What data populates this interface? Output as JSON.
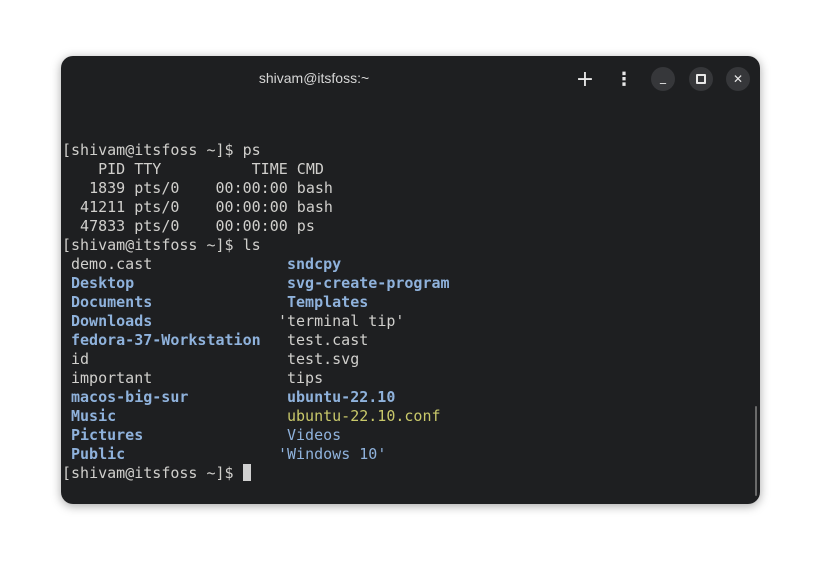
{
  "window": {
    "title": "shivam@itsfoss:~"
  },
  "header_buttons": {
    "new_tab": "+",
    "menu": "⋮",
    "minimize": "_",
    "maximize": "▫",
    "close": "✕"
  },
  "prompt": "[shivam@itsfoss ~]$ ",
  "commands": {
    "ps": "ps",
    "ls": "ls"
  },
  "ps_output": [
    "    PID TTY          TIME CMD",
    "   1839 pts/0    00:00:00 bash",
    "  41211 pts/0    00:00:00 bash",
    "  47833 pts/0    00:00:00 ps"
  ],
  "ls_output": [
    [
      {
        "name": "demo.cast",
        "type": "file"
      },
      {
        "name": "sndcpy",
        "type": "dir"
      }
    ],
    [
      {
        "name": "Desktop",
        "type": "dir"
      },
      {
        "name": "svg-create-program",
        "type": "dir"
      }
    ],
    [
      {
        "name": "Documents",
        "type": "dir"
      },
      {
        "name": "Templates",
        "type": "dir"
      }
    ],
    [
      {
        "name": "Downloads",
        "type": "dir"
      },
      {
        "name": "'terminal tip'",
        "type": "file",
        "quoted": true
      }
    ],
    [
      {
        "name": "fedora-37-Workstation",
        "type": "dir"
      },
      {
        "name": "test.cast",
        "type": "file"
      }
    ],
    [
      {
        "name": "id",
        "type": "file"
      },
      {
        "name": "test.svg",
        "type": "file"
      }
    ],
    [
      {
        "name": "important",
        "type": "file"
      },
      {
        "name": "tips",
        "type": "file"
      }
    ],
    [
      {
        "name": "macos-big-sur",
        "type": "dir"
      },
      {
        "name": "ubuntu-22.10",
        "type": "dir"
      }
    ],
    [
      {
        "name": "Music",
        "type": "dir"
      },
      {
        "name": "ubuntu-22.10.conf",
        "type": "yellow"
      }
    ],
    [
      {
        "name": "Pictures",
        "type": "dir"
      },
      {
        "name": "Videos",
        "type": "dirn"
      }
    ],
    [
      {
        "name": "Public",
        "type": "dir"
      },
      {
        "name": "'Windows 10'",
        "type": "dirn",
        "quoted": true
      }
    ]
  ]
}
